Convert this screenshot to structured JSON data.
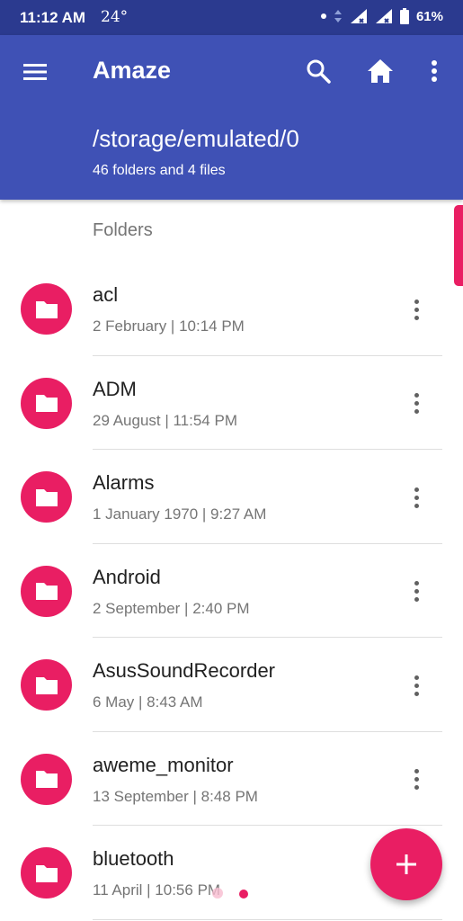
{
  "status_bar": {
    "time": "11:12 AM",
    "temperature": "24°",
    "battery": "61%",
    "icons": [
      "notification-dot-icon",
      "data-arrows-icon",
      "signal-icon",
      "signal-icon",
      "battery-icon"
    ]
  },
  "toolbar": {
    "title": "Amaze",
    "path": "/storage/emulated/0",
    "summary": "46 folders and 4 files",
    "icons": [
      "menu-icon",
      "search-icon",
      "home-icon",
      "more-vert-icon"
    ]
  },
  "section_header": "Folders",
  "folders": [
    {
      "name": "acl",
      "date": "2 February | 10:14 PM"
    },
    {
      "name": "ADM",
      "date": "29 August | 11:54 PM"
    },
    {
      "name": "Alarms",
      "date": "1 January 1970 | 9:27 AM"
    },
    {
      "name": "Android",
      "date": "2 September | 2:40 PM"
    },
    {
      "name": "AsusSoundRecorder",
      "date": "6 May | 8:43 AM"
    },
    {
      "name": "aweme_monitor",
      "date": "13 September | 8:48 PM"
    },
    {
      "name": "bluetooth",
      "date": "11 April | 10:56 PM"
    }
  ],
  "fab": {
    "icon": "plus-icon"
  },
  "colors": {
    "status_bar": "#2b3a8f",
    "primary": "#3f51b5",
    "accent": "#e91e63",
    "secondary_text": "#757575"
  }
}
